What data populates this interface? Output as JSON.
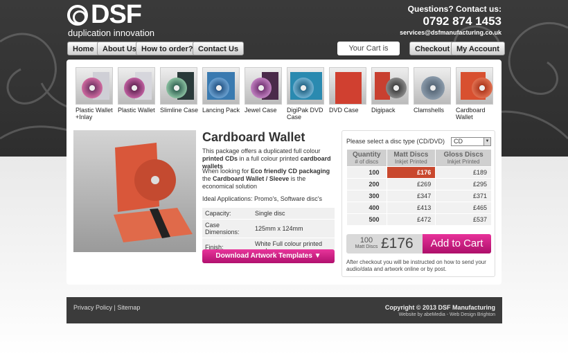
{
  "header": {
    "logo_text": "DSF",
    "tagline": "duplication innovation",
    "contact_label": "Questions? Contact us:",
    "phone": "0792 874 1453",
    "email": "services@dsfmanufacturing.co.uk"
  },
  "nav": {
    "home": "Home",
    "about": "About Us",
    "how_to_order": "How to order?",
    "contact": "Contact Us",
    "cart_status": "Your Cart is empty.",
    "checkout": "Checkout",
    "account": "My Account"
  },
  "products": [
    {
      "label": "Plastic Wallet +Inlay",
      "icon": "plastic-wallet-inlay-thumbnail"
    },
    {
      "label": "Plastic Wallet",
      "icon": "plastic-wallet-thumbnail"
    },
    {
      "label": "Slimline Case",
      "icon": "slimline-case-thumbnail"
    },
    {
      "label": "Lancing Pack",
      "icon": "lancing-pack-thumbnail"
    },
    {
      "label": "Jewel Case",
      "icon": "jewel-case-thumbnail"
    },
    {
      "label": "DigiPak DVD Case",
      "icon": "digipak-dvd-case-thumbnail"
    },
    {
      "label": "DVD Case",
      "icon": "dvd-case-thumbnail"
    },
    {
      "label": "Digipack",
      "icon": "digipack-thumbnail"
    },
    {
      "label": "Clamshells",
      "icon": "clamshells-thumbnail"
    },
    {
      "label": "Cardboard Wallet",
      "icon": "cardboard-wallet-thumbnail"
    }
  ],
  "detail": {
    "title": "Cardboard Wallet",
    "p1_a": "This package offers a duplicated full colour ",
    "p1_b": "printed CDs",
    "p1_c": " in a full colour printed ",
    "p1_d": "cardboard wallets",
    "p2_a": "When looking for ",
    "p2_b": "Eco friendly CD packaging",
    "p2_c": " the ",
    "p2_d": "Cardboard Wallet / Sleeve",
    "p2_e": " is the economical solution",
    "p3": "Ideal Applications: Promo's, Software disc's",
    "specs": [
      {
        "k": "Capacity:",
        "v": "Single disc"
      },
      {
        "k": "Case Dimensions:",
        "v": "125mm x 124mm"
      },
      {
        "k": "Finish:",
        "v": "White Full colour printed card"
      }
    ],
    "download_label": "Download Artwork Templates ▼"
  },
  "order": {
    "select_label": "Please select a disc type (CD/DVD)",
    "disc_type": "CD",
    "headers": {
      "qty": "Quantity",
      "qty_sub": "# of discs",
      "matt": "Matt Discs",
      "matt_sub": "Inkjet Printed",
      "gloss": "Gloss Discs",
      "gloss_sub": "Inkjet Printed"
    },
    "rows": [
      {
        "q": "100",
        "matt": "£176",
        "gloss": "£189",
        "selected": true
      },
      {
        "q": "200",
        "matt": "£269",
        "gloss": "£295"
      },
      {
        "q": "300",
        "matt": "£347",
        "gloss": "£371"
      },
      {
        "q": "400",
        "matt": "£413",
        "gloss": "£465"
      },
      {
        "q": "500",
        "matt": "£472",
        "gloss": "£537"
      }
    ],
    "summary_qty": "100",
    "summary_type": "Matt Discs",
    "summary_price": "£176",
    "add_to_cart": "Add to Cart",
    "note": "After checkout you will be instructed on how to send your audio/data and artwork online or by post."
  },
  "footer": {
    "privacy": "Privacy Policy",
    "sep": " | ",
    "sitemap": "Sitemap",
    "copyright": "Copyright © 2013 DSF Manufacturing",
    "credit": "Website by abeMedia - Web Design Brighton"
  },
  "colors": {
    "accent": "#c9137e",
    "selected_price": "#c9482e",
    "header_bg": "#333333"
  }
}
